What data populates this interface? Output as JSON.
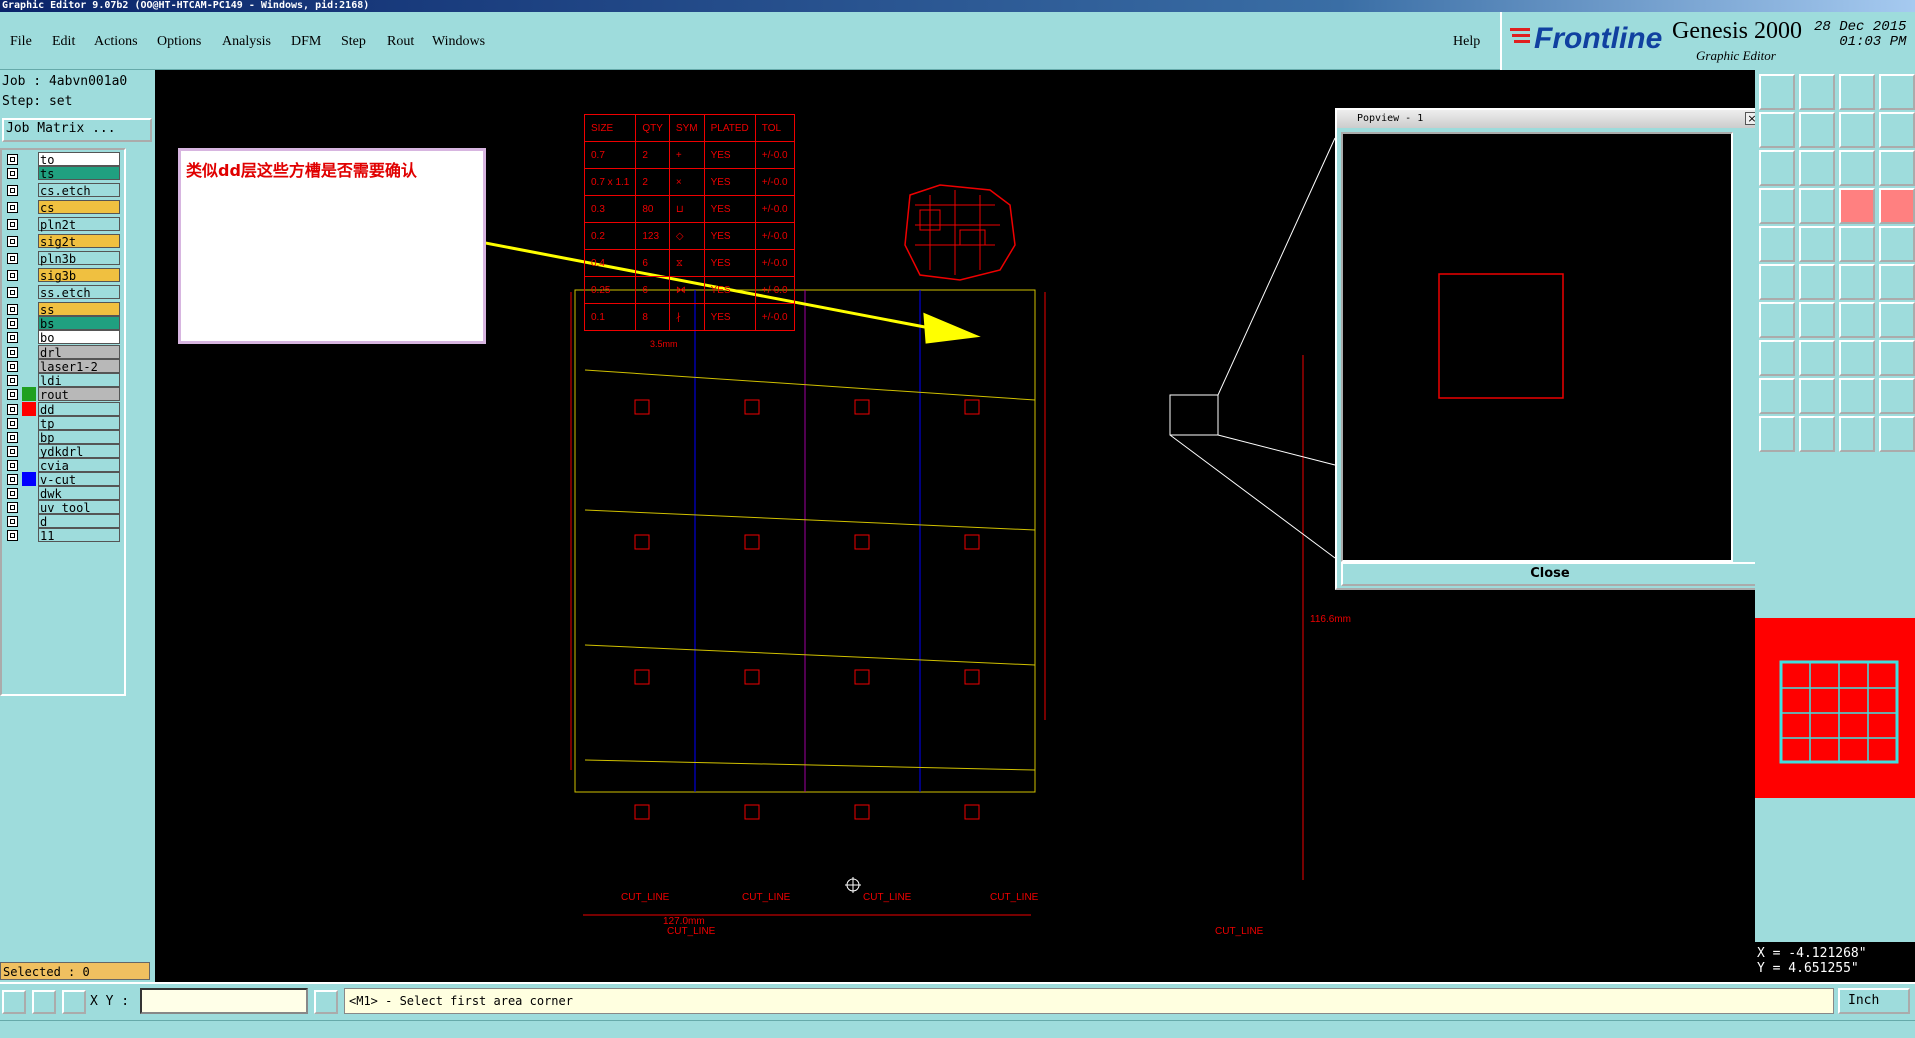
{
  "window": {
    "title": "Graphic Editor 9.07b2 (OO@HT-HTCAM-PC149 - Windows, pid:2168)"
  },
  "menu": {
    "items": [
      "File",
      "Edit",
      "Actions",
      "Options",
      "Analysis",
      "DFM",
      "Step",
      "Rout",
      "Windows"
    ],
    "help": "Help"
  },
  "brand": {
    "logo": "Frontline",
    "product": "Genesis 2000",
    "subtitle": "Graphic Editor",
    "date": "28 Dec 2015",
    "time": "01:03 PM"
  },
  "job": {
    "job_label": "Job : 4abvn001a0",
    "step_label": "Step: set",
    "matrix_button": "Job Matrix ..."
  },
  "layers": [
    {
      "name": "to",
      "color": "#ffffff",
      "swatch": ""
    },
    {
      "name": "ts",
      "color": "#20a080",
      "swatch": ""
    },
    {
      "name": "cs.etch",
      "color": "#9edcdc",
      "swatch": ""
    },
    {
      "name": "cs",
      "color": "#f0c040",
      "swatch": ""
    },
    {
      "name": "pln2t",
      "color": "#9edcdc",
      "swatch": ""
    },
    {
      "name": "sig2t",
      "color": "#f0c040",
      "swatch": ""
    },
    {
      "name": "pln3b",
      "color": "#9edcdc",
      "swatch": ""
    },
    {
      "name": "sig3b",
      "color": "#f0c040",
      "swatch": ""
    },
    {
      "name": "ss.etch",
      "color": "#9edcdc",
      "swatch": ""
    },
    {
      "name": "ss",
      "color": "#f0c040",
      "swatch": ""
    },
    {
      "name": "bs",
      "color": "#20a080",
      "swatch": ""
    },
    {
      "name": "bo",
      "color": "#ffffff",
      "swatch": ""
    },
    {
      "name": "drl",
      "color": "#b8b8b8",
      "swatch": ""
    },
    {
      "name": "laser1-2",
      "color": "#b8b8b8",
      "swatch": ""
    },
    {
      "name": "ldi",
      "color": "#9edcdc",
      "swatch": ""
    },
    {
      "name": "rout",
      "color": "#b8b8b8",
      "swatch": "#20a020"
    },
    {
      "name": "dd",
      "color": "#9edcdc",
      "swatch": "#ff0000"
    },
    {
      "name": "tp",
      "color": "#9edcdc",
      "swatch": ""
    },
    {
      "name": "bp",
      "color": "#9edcdc",
      "swatch": ""
    },
    {
      "name": "ydkdrl",
      "color": "#9edcdc",
      "swatch": ""
    },
    {
      "name": "cvia",
      "color": "#9edcdc",
      "swatch": ""
    },
    {
      "name": "v-cut",
      "color": "#9edcdc",
      "swatch": "#0000ff"
    },
    {
      "name": "dwk",
      "color": "#9edcdc",
      "swatch": ""
    },
    {
      "name": "uv_tool",
      "color": "#9edcdc",
      "swatch": ""
    },
    {
      "name": "d",
      "color": "#9edcdc",
      "swatch": ""
    },
    {
      "name": "11",
      "color": "#9edcdc",
      "swatch": ""
    }
  ],
  "selected": "Selected : 0",
  "note": {
    "text": "类似dd层这些方槽是否需要确认"
  },
  "drill_table": {
    "headers": [
      "SIZE",
      "QTY",
      "SYM",
      "PLATED",
      "TOL"
    ],
    "rows": [
      [
        "0.7",
        "2",
        "+",
        "YES",
        "+/-0.0"
      ],
      [
        "0.7 x 1.1",
        "2",
        "×",
        "YES",
        "+/-0.0"
      ],
      [
        "0.3",
        "80",
        "⊔",
        "YES",
        "+/-0.0"
      ],
      [
        "0.2",
        "123",
        "◇",
        "YES",
        "+/-0.0"
      ],
      [
        "0.4",
        "6",
        "⧖",
        "YES",
        "+/-0.0"
      ],
      [
        "0.25",
        "6",
        "⋈",
        "YES",
        "+/-0.0"
      ],
      [
        "0.1",
        "8",
        "∤",
        "YES",
        "+/-0.0"
      ]
    ]
  },
  "drawing": {
    "small_dim": "3.5mm",
    "width_dim": "127.0mm",
    "height_dim": "116.6mm",
    "cut_label": "CUT_LINE"
  },
  "popview": {
    "title": "Popview - 1",
    "close_button": "Close"
  },
  "coords": {
    "x": "X = -4.121268\"",
    "y": "Y = 4.651255\""
  },
  "bottom": {
    "xy_label": "X Y :",
    "xy_value": "",
    "message": "<M1> - Select first area corner",
    "unit": "Inch"
  },
  "colors": {
    "panel": "#9edcdc",
    "canvas": "#000000",
    "accent_red": "#ff0000",
    "selected": "#f0c060"
  }
}
